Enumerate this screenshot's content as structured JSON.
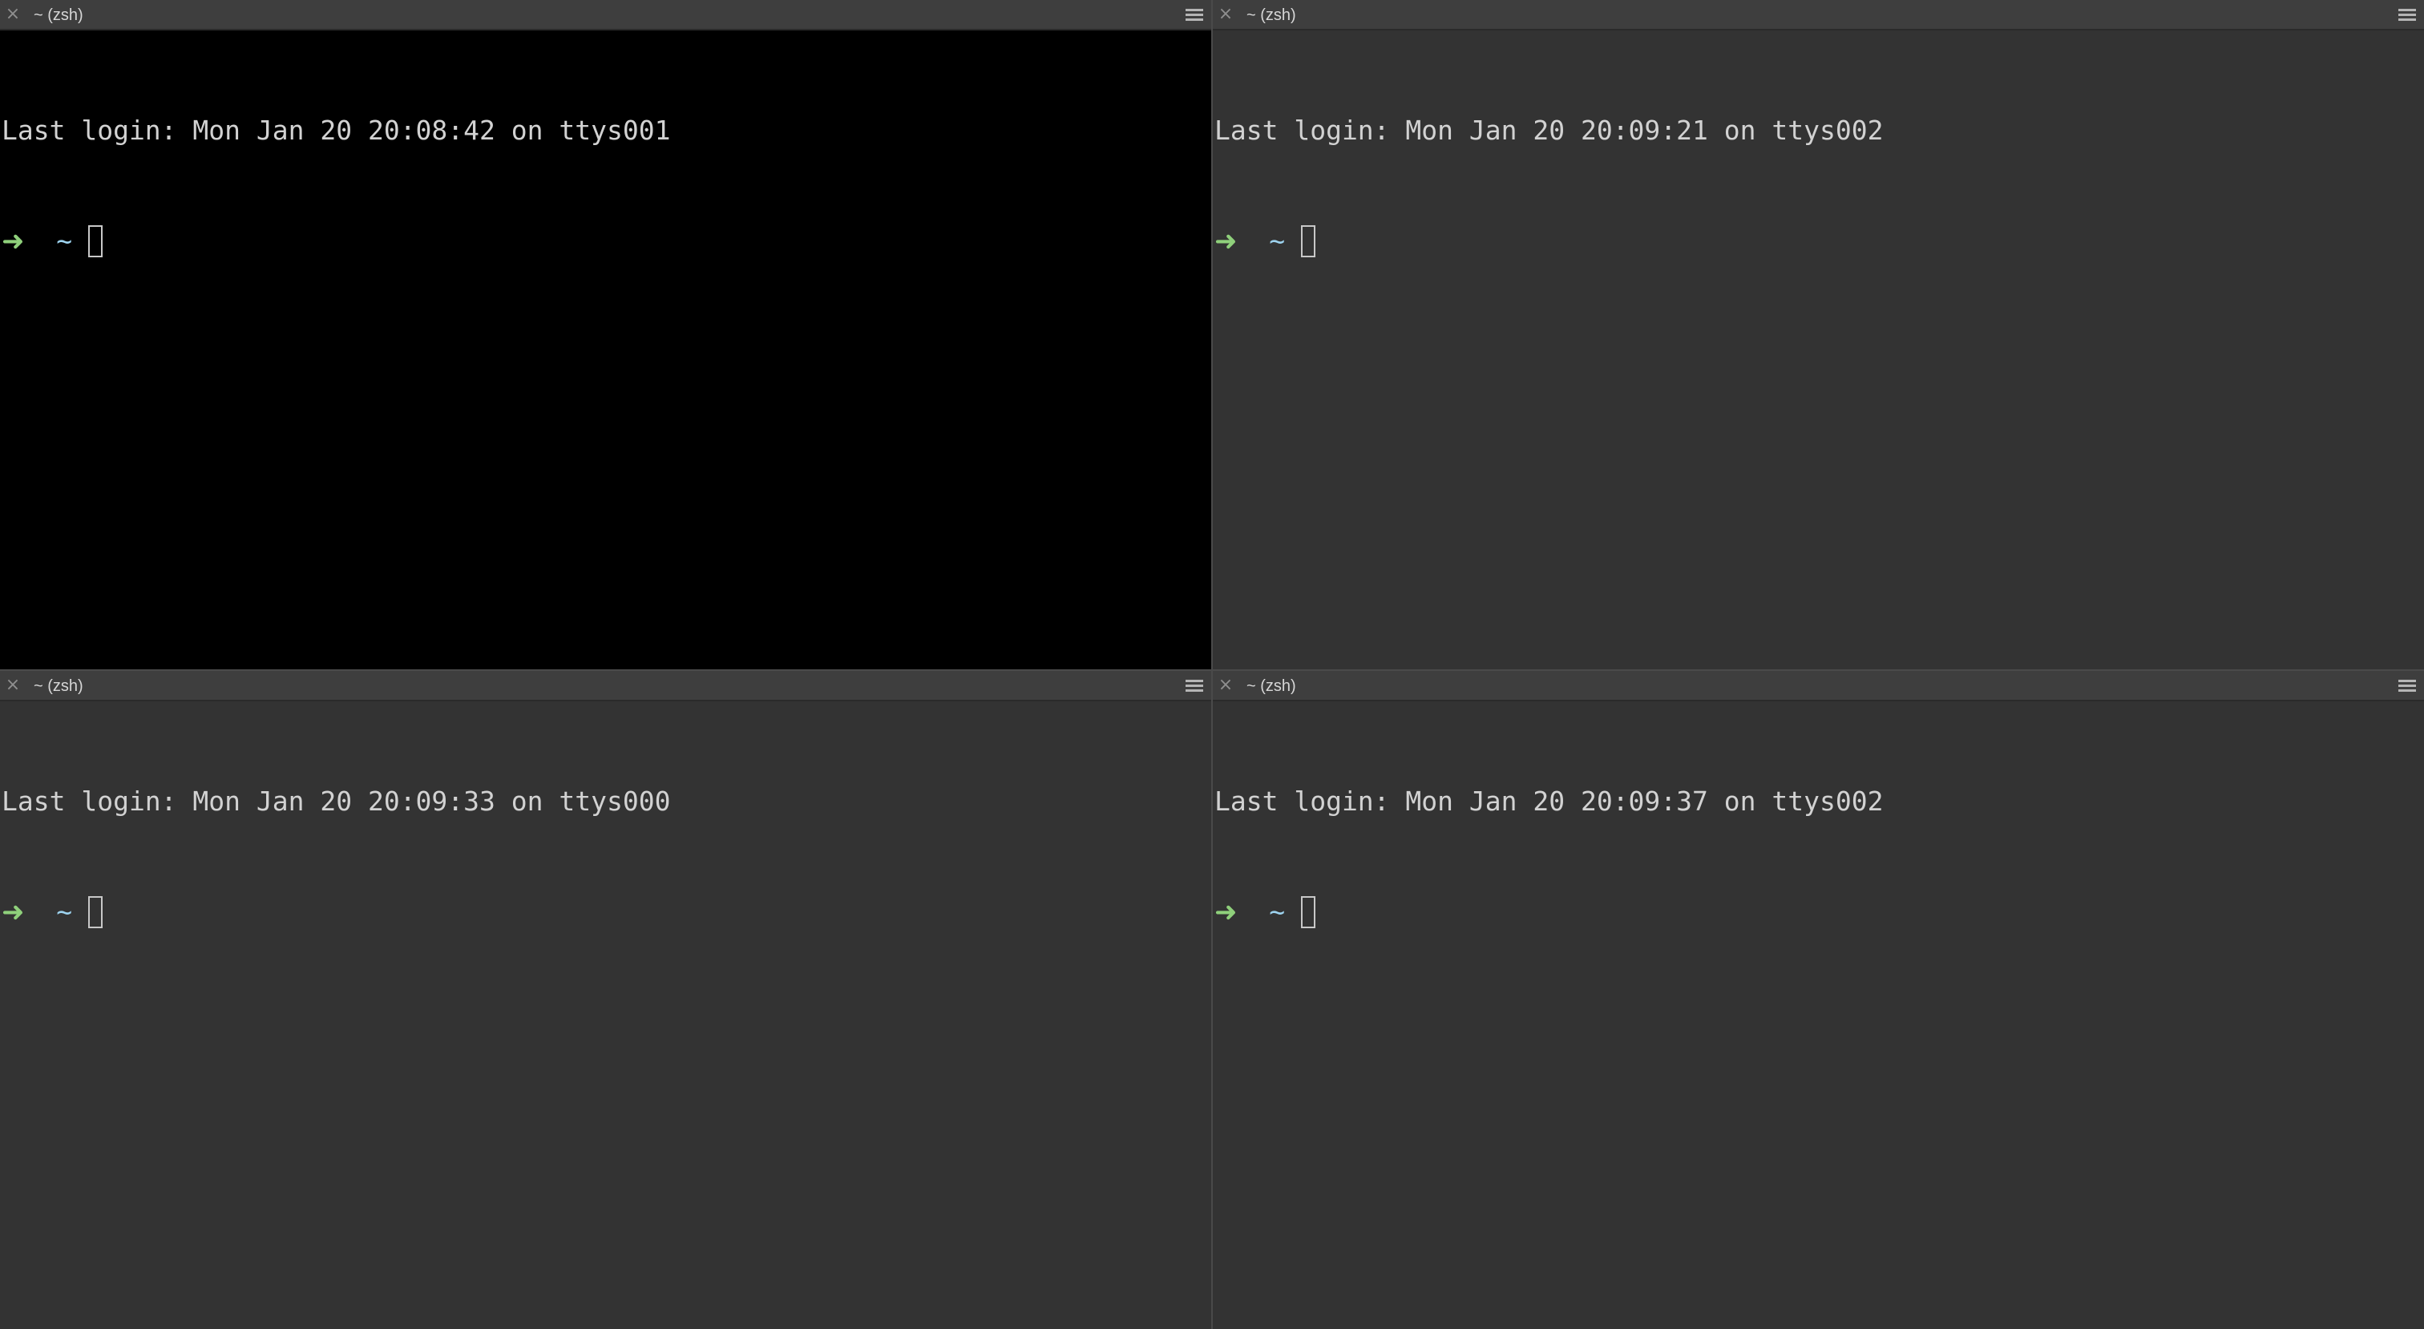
{
  "panes": [
    {
      "tab_title": "~ (zsh)",
      "login_text": "Last login: Mon Jan 20 20:08:42 on ttys001",
      "prompt_arrow": "➜",
      "prompt_dir": "~",
      "active": true
    },
    {
      "tab_title": "~ (zsh)",
      "login_text": "Last login: Mon Jan 20 20:09:21 on ttys002",
      "prompt_arrow": "➜",
      "prompt_dir": "~",
      "active": false
    },
    {
      "tab_title": "~ (zsh)",
      "login_text": "Last login: Mon Jan 20 20:09:33 on ttys000",
      "prompt_arrow": "➜",
      "prompt_dir": "~",
      "active": false
    },
    {
      "tab_title": "~ (zsh)",
      "login_text": "Last login: Mon Jan 20 20:09:37 on ttys002",
      "prompt_arrow": "➜",
      "prompt_dir": "~",
      "active": false
    }
  ],
  "icons": {
    "close": "close-icon",
    "menu": "hamburger-menu-icon"
  },
  "colors": {
    "active_background": "#000000",
    "inactive_background": "#333333",
    "text": "#d2d2d2",
    "prompt_arrow": "#8fd07b",
    "prompt_dir": "#9ed4f0"
  }
}
